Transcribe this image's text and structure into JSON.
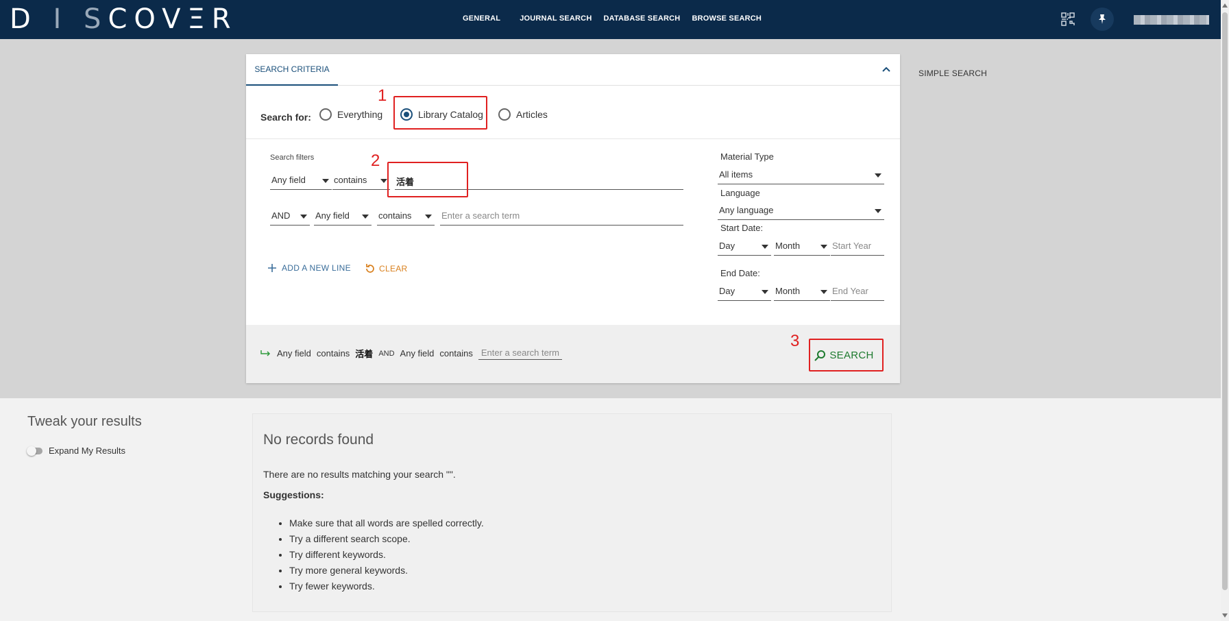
{
  "header": {
    "logo": [
      "D",
      " I ",
      "S",
      "COV",
      "Ξ",
      "R"
    ],
    "nav": [
      "GENERAL",
      "JOURNAL SEARCH",
      "DATABASE SEARCH",
      "BROWSE SEARCH"
    ]
  },
  "card": {
    "tab_label": "SEARCH CRITERIA",
    "search_for_label": "Search for:",
    "radios": [
      "Everything",
      "Library Catalog",
      "Articles"
    ],
    "selected_radio": "Library Catalog",
    "filters_label": "Search filters",
    "row1": {
      "field": "Any field",
      "op": "contains",
      "value": "活着"
    },
    "row2": {
      "bool": "AND",
      "field": "Any field",
      "op": "contains",
      "placeholder": "Enter a search term"
    },
    "add_line": "ADD A NEW LINE",
    "clear": "CLEAR",
    "material_type_label": "Material Type",
    "material_type_value": "All items",
    "language_label": "Language",
    "language_value": "Any language",
    "start_date_label": "Start Date:",
    "end_date_label": "End Date:",
    "day": "Day",
    "month": "Month",
    "start_year_placeholder": "Start Year",
    "end_year_placeholder": "End Year",
    "summary": {
      "f1": "Any field",
      "op1": "contains",
      "kw1": "活着",
      "bool": "AND",
      "f2": "Any field",
      "op2": "contains",
      "ph2": "Enter a search term"
    },
    "search_button": "SEARCH"
  },
  "annotations": [
    "1",
    "2",
    "3"
  ],
  "simple_search": "SIMPLE SEARCH",
  "sidebar": {
    "title": "Tweak your results",
    "toggle_label": "Expand My Results"
  },
  "results": {
    "title": "No records found",
    "message": "There are no results matching your search \"\".",
    "suggestions_label": "Suggestions:",
    "suggestions": [
      "Make sure that all words are spelled correctly.",
      "Try a different search scope.",
      "Try different keywords.",
      "Try more general keywords.",
      "Try fewer keywords."
    ]
  },
  "colors": {
    "header_bg": "#0b2a4a",
    "accent_blue": "#1a4f7a",
    "annotation_red": "#e02020",
    "search_green": "#1d7a2e",
    "clear_orange": "#d9801e"
  }
}
